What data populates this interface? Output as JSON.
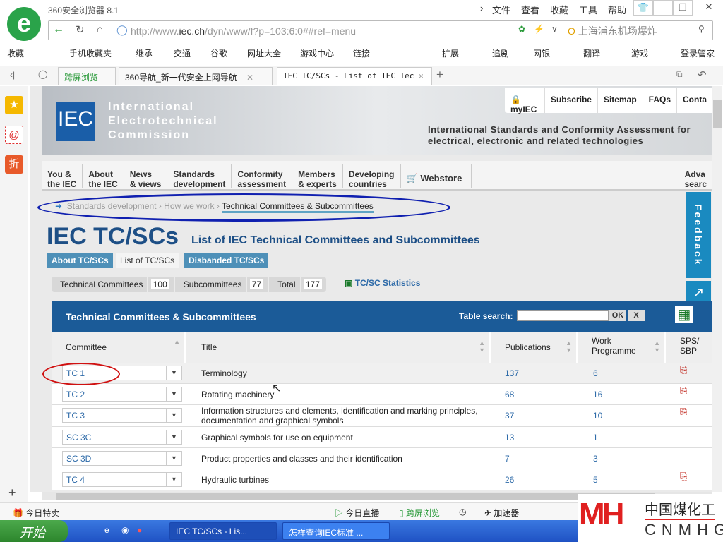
{
  "browser": {
    "title": "360安全浏览器 8.1",
    "menu": [
      "文件",
      "查看",
      "收藏",
      "工具",
      "帮助"
    ],
    "url_host": "http://www.",
    "url_domain": "iec.ch",
    "url_path": "/dyn/www/f?p=103:6:0##ref=menu",
    "search_placeholder": "上海浦东机场爆炸"
  },
  "bookmarks": [
    "收藏",
    "手机收藏夹",
    "继承",
    "交通",
    "谷歌",
    "网址大全",
    "游戏中心",
    "链接",
    "扩展",
    "追剧",
    "网银",
    "翻译",
    "游戏",
    "登录管家"
  ],
  "tabs": [
    {
      "label": "跨屏浏览"
    },
    {
      "label": "360导航_新一代安全上网导航"
    },
    {
      "label": "IEC TC/SCs - List of IEC Tec"
    }
  ],
  "site": {
    "logo": "IEC",
    "org_name": [
      "International",
      "Electrotechnical",
      "Commission"
    ],
    "toplinks": [
      "myIEC",
      "Subscribe",
      "Sitemap",
      "FAQs",
      "Conta"
    ],
    "tagline": [
      "International Standards and Conformity Assessment for",
      "electrical, electronic and related technologies"
    ],
    "nav": [
      [
        "You &",
        "the IEC"
      ],
      [
        "About",
        "the IEC"
      ],
      [
        "News",
        "& views"
      ],
      [
        "Standards",
        "development"
      ],
      [
        "Conformity",
        "assessment"
      ],
      [
        "Members",
        "& experts"
      ],
      [
        "Developing",
        "countries"
      ],
      [
        "Webstore",
        ""
      ],
      [
        "Adva",
        "searc"
      ]
    ],
    "breadcrumb": [
      "Standards development",
      "How we work",
      "Technical Committees & Subcommittees"
    ],
    "title": "IEC TC/SCs",
    "subtitle": "List of IEC Technical Committees and Subcommittees",
    "page_tabs": [
      "About TC/SCs",
      "List of TC/SCs",
      "Disbanded TC/SCs"
    ],
    "counts": [
      {
        "label": "Technical Committees",
        "value": "100"
      },
      {
        "label": "Subcommittees",
        "value": "77"
      },
      {
        "label": "Total",
        "value": "177"
      }
    ],
    "stats_link": "TC/SC Statistics",
    "feedback": "Feedback"
  },
  "table": {
    "title": "Technical Committees & Subcommittees",
    "search_label": "Table search:",
    "ok": "OK",
    "clear": "X",
    "columns": [
      "Committee",
      "Title",
      "Publications",
      "Work Programme",
      "SPS/ SBP"
    ],
    "rows": [
      {
        "committee": "TC 1",
        "title": "Terminology",
        "pubs": "137",
        "work": "6",
        "pdf": true
      },
      {
        "committee": "TC 2",
        "title": "Rotating machinery",
        "pubs": "68",
        "work": "16",
        "pdf": true
      },
      {
        "committee": "TC 3",
        "title": "Information structures and elements, identification and marking principles, documentation and graphical symbols",
        "pubs": "37",
        "work": "10",
        "pdf": true
      },
      {
        "committee": "SC 3C",
        "title": "Graphical symbols for use on equipment",
        "pubs": "13",
        "work": "1",
        "pdf": false
      },
      {
        "committee": "SC 3D",
        "title": "Product properties and classes and their identification",
        "pubs": "7",
        "work": "3",
        "pdf": false
      },
      {
        "committee": "TC 4",
        "title": "Hydraulic turbines",
        "pubs": "26",
        "work": "5",
        "pdf": true
      }
    ]
  },
  "statusbar": [
    "今日特卖",
    "今日直播",
    "跨屏浏览",
    "加速器"
  ],
  "taskbar": {
    "start": "开始",
    "tasks": [
      "IEC TC/SCs - Lis...",
      "怎样查询IEC标准 ..."
    ]
  },
  "watermark": {
    "cn": "中国煤化工",
    "en": "CNMHG"
  }
}
